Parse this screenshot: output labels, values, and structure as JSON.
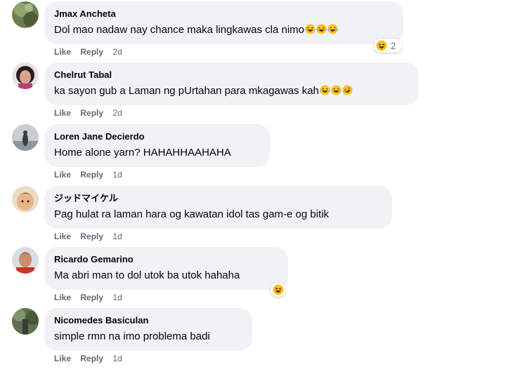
{
  "comments": [
    {
      "author": "Jmax Ancheta",
      "text": "Dol mao nadaw nay chance maka lingkawas cla nimo",
      "emojis": [
        "laughing-tears",
        "laughing-tears",
        "laughing-tears"
      ],
      "like": "Like",
      "reply": "Reply",
      "time": "2d",
      "reaction": {
        "icon": "haha-reaction-icon",
        "count": "2"
      }
    },
    {
      "author": "Chelrut Tabal",
      "text": "ka sayon gub a Laman ng pUrtahan para mkagawas kah",
      "emojis": [
        "laughing-tears",
        "laughing-tears",
        "rolling-laughing"
      ],
      "like": "Like",
      "reply": "Reply",
      "time": "2d"
    },
    {
      "author": "Loren Jane Decierdo",
      "text": "Home alone yarn? HAHAHHAAHAHA",
      "like": "Like",
      "reply": "Reply",
      "time": "1d"
    },
    {
      "author": "ジッドマイケル",
      "text": "Pag hulat ra laman hara og kawatan idol tas gam-e og bitik",
      "like": "Like",
      "reply": "Reply",
      "time": "1d"
    },
    {
      "author": "Ricardo Gemarino",
      "text": "Ma abri man to dol utok ba utok hahaha",
      "like": "Like",
      "reply": "Reply",
      "time": "1d",
      "reaction": {
        "icon": "haha-reaction-icon",
        "count": ""
      }
    },
    {
      "author": "Nicomedes Basiculan",
      "text": "simple rmn na imo problema badi",
      "like": "Like",
      "reply": "Reply",
      "time": "1d"
    }
  ],
  "colors": {
    "bubble": "#f0f2f5",
    "meta_text": "#65676b",
    "emoji_face": "#fcc21b"
  }
}
